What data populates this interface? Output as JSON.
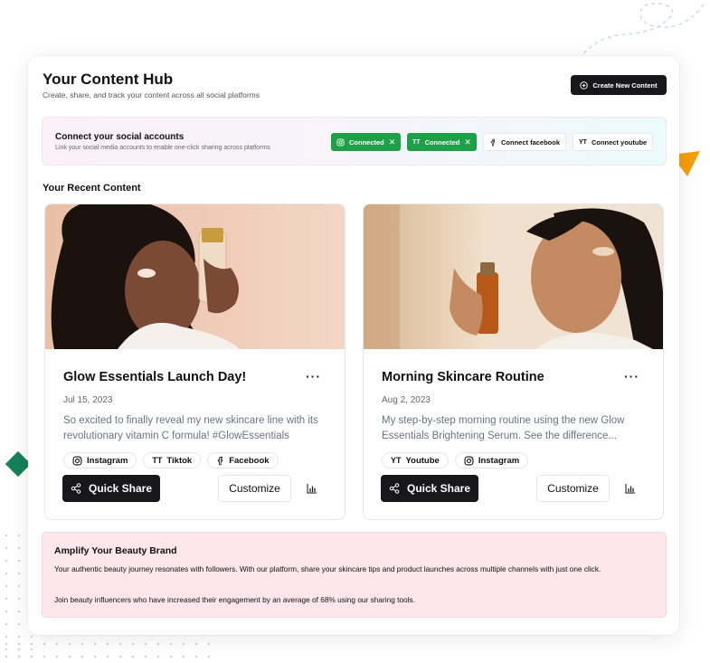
{
  "header": {
    "title": "Your Content Hub",
    "subtitle": "Create, share, and track your content across all social platforms",
    "create_label": "Create New Content"
  },
  "connect": {
    "title": "Connect your social accounts",
    "subtitle": "Link your social media accounts to enable one-click sharing across platforms",
    "accounts": [
      {
        "icon": "instagram-icon",
        "prefix": "",
        "label": "Connected",
        "state": "connected"
      },
      {
        "icon": "tiktok-icon",
        "prefix": "TT",
        "label": "Connected",
        "state": "connected"
      },
      {
        "icon": "facebook-icon",
        "prefix": "",
        "label": "Connect facebook",
        "state": "disconnected"
      },
      {
        "icon": "youtube-icon",
        "prefix": "YT",
        "label": "Connect youtube",
        "state": "disconnected"
      }
    ]
  },
  "recent_title": "Your Recent Content",
  "posts": [
    {
      "title": "Glow Essentials Launch Day!",
      "date": "Jul 15, 2023",
      "body": "So excited to finally reveal my new skincare line with its revolutionary vitamin C formula! #GlowEssentials",
      "tags": [
        {
          "icon": "instagram-icon",
          "prefix": "",
          "label": "Instagram"
        },
        {
          "icon": "tiktok-icon",
          "prefix": "TT",
          "label": "Tiktok"
        },
        {
          "icon": "facebook-icon",
          "prefix": "",
          "label": "Facebook"
        }
      ],
      "share_label": "Quick Share",
      "customize_label": "Customize",
      "more_label": "···"
    },
    {
      "title": "Morning Skincare Routine",
      "date": "Aug 2, 2023",
      "body": "My step-by-step morning routine using the new Glow Essentials Brightening Serum. See the difference...",
      "tags": [
        {
          "icon": "youtube-icon",
          "prefix": "YT",
          "label": "Youtube"
        },
        {
          "icon": "instagram-icon",
          "prefix": "",
          "label": "Instagram"
        }
      ],
      "share_label": "Quick Share",
      "customize_label": "Customize",
      "more_label": "···"
    }
  ],
  "amplify": {
    "title": "Amplify Your Beauty Brand",
    "p1": "Your authentic beauty journey resonates with followers. With our platform, share your skincare tips and product launches across multiple channels with just one click.",
    "p2": "Join beauty influencers who have increased their engagement by an average of 68% using our sharing tools."
  },
  "colors": {
    "accent_dark": "#18181b",
    "connected_green": "#1ea048",
    "amplify_bg": "#fde6ec",
    "deco_green": "#15805a",
    "deco_orange": "#f59e0b"
  }
}
